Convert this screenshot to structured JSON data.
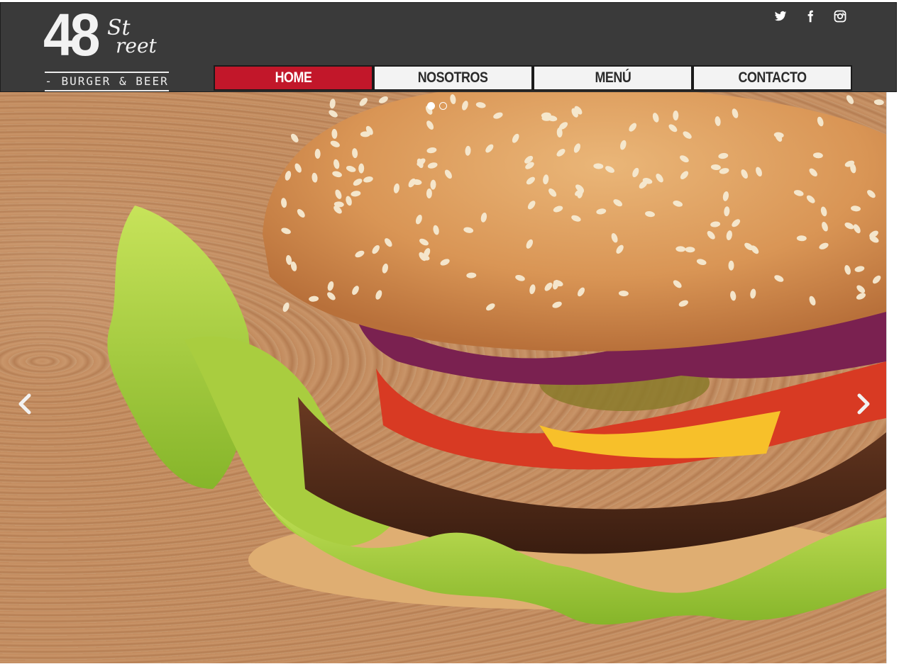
{
  "brand": {
    "number": "48",
    "street_top": "St",
    "street_bottom": "reet",
    "tagline": "- BURGER & BEER -"
  },
  "social": [
    {
      "name": "twitter",
      "icon": "twitter-icon"
    },
    {
      "name": "facebook",
      "icon": "facebook-icon"
    },
    {
      "name": "instagram",
      "icon": "instagram-icon"
    }
  ],
  "nav": {
    "items": [
      {
        "label": "HOME",
        "active": true
      },
      {
        "label": "NOSOTROS",
        "active": false
      },
      {
        "label": "MENÚ",
        "active": false
      },
      {
        "label": "CONTACTO",
        "active": false
      }
    ]
  },
  "carousel": {
    "slide_count": 2,
    "active_index": 0,
    "prev_icon": "chevron-left-icon",
    "next_icon": "chevron-right-icon"
  },
  "colors": {
    "header_bg": "#3a3a3a",
    "accent": "#c2172a",
    "nav_bg": "#f3f3f3"
  }
}
